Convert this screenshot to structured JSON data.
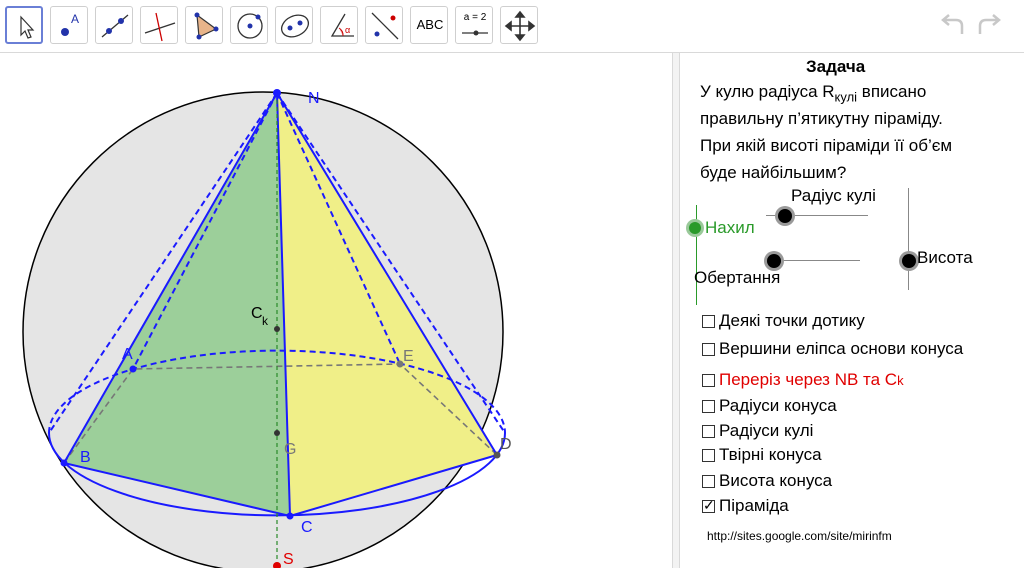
{
  "toolbar": {
    "tools": [
      {
        "name": "move-tool",
        "label": ""
      },
      {
        "name": "point-tool",
        "label": "A"
      },
      {
        "name": "line-tool",
        "label": ""
      },
      {
        "name": "perpendicular-tool",
        "label": ""
      },
      {
        "name": "polygon-tool",
        "label": ""
      },
      {
        "name": "circle-tool",
        "label": ""
      },
      {
        "name": "ellipse-tool",
        "label": ""
      },
      {
        "name": "angle-tool",
        "label": "α"
      },
      {
        "name": "reflect-tool",
        "label": ""
      },
      {
        "name": "text-tool",
        "label": "ABC"
      },
      {
        "name": "slider-tool",
        "label": "a = 2"
      },
      {
        "name": "move-view-tool",
        "label": ""
      }
    ]
  },
  "figure": {
    "labels": {
      "N": "N",
      "C": "C",
      "k": "k",
      "A": "A",
      "E": "E",
      "B": "B",
      "D": "D",
      "G": "G",
      "Cpt": "C",
      "S": "S"
    }
  },
  "panel": {
    "title": "Задача",
    "problem_line1_pre": "У кулю радіуса R",
    "problem_line1_sub": "кулі",
    "problem_line1_post": " вписано",
    "problem_line2": "правильну п’ятикутну піраміду.",
    "problem_line3": "При якій висоті піраміди її об’єм",
    "problem_line4": "буде найбільшим?",
    "sliders": {
      "radius": "Радіус кулі",
      "tilt": "Нахил",
      "rotation": "Обертання",
      "height": "Висота"
    },
    "checkboxes": [
      {
        "label": "Деякі точки дотику",
        "checked": false,
        "color": "#000000"
      },
      {
        "label": "Вершини еліпса основи конуса",
        "checked": false,
        "color": "#000000"
      },
      {
        "label": "Переріз через NB та C",
        "sub": "k",
        "checked": false,
        "color": "#e00000"
      },
      {
        "label": "Радіуси конуса",
        "checked": false,
        "color": "#000000"
      },
      {
        "label": "Радіуси кулі",
        "checked": false,
        "color": "#000000"
      },
      {
        "label": "Твірні конуса",
        "checked": false,
        "color": "#000000"
      },
      {
        "label": "Висота конуса",
        "checked": false,
        "color": "#000000"
      },
      {
        "label": "Піраміда",
        "checked": true,
        "color": "#000000"
      }
    ],
    "url": "http://sites.google.com/site/mirinfm"
  }
}
